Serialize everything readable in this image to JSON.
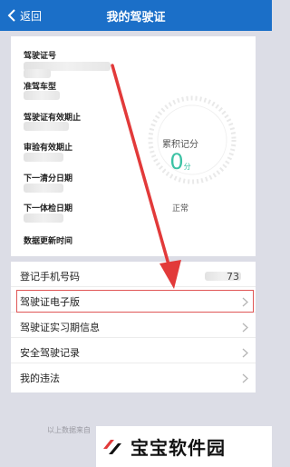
{
  "topbar": {
    "back_label": "返回",
    "title": "我的驾驶证"
  },
  "license_card": {
    "fields": [
      "驾驶证号",
      "准驾车型",
      "驾驶证有效期止",
      "审验有效期止",
      "下一清分日期",
      "下一体检日期",
      "数据更新时间"
    ],
    "score_title": "累积记分",
    "score_value": "0",
    "score_unit": "分",
    "status": "正常"
  },
  "menu": {
    "phone_label": "登记手机号码",
    "phone_suffix": "73",
    "items": [
      "驾驶证电子版",
      "驾驶证实习期信息",
      "安全驾驶记录",
      "我的违法"
    ]
  },
  "footer": {
    "note": "以上数据来自"
  },
  "watermark": {
    "text": "宝宝软件园"
  },
  "colors": {
    "header": "#1b6fc8",
    "accent_green": "#3cc2a4",
    "highlight_red": "#e05656"
  }
}
